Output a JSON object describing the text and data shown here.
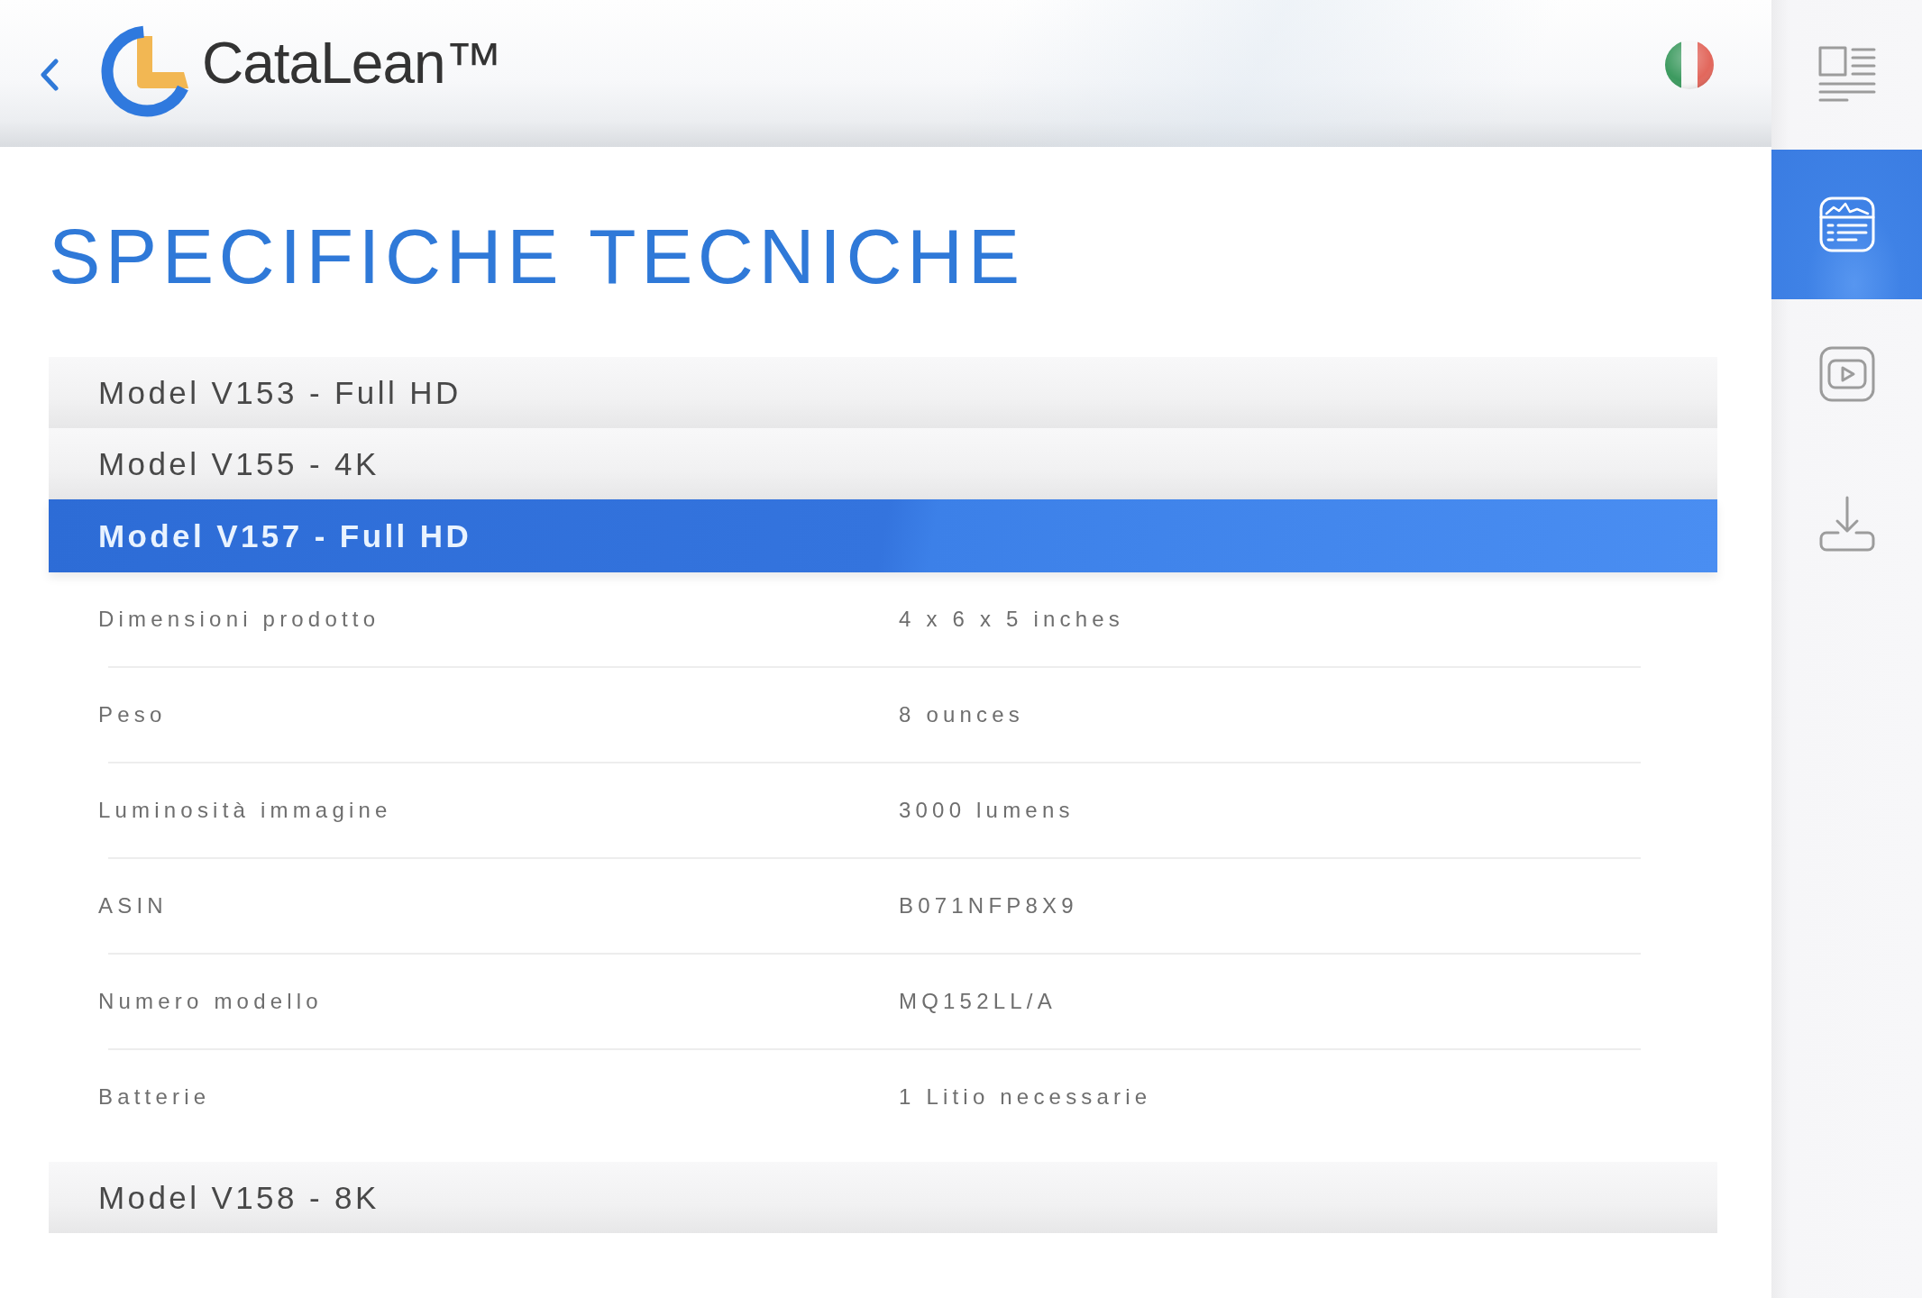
{
  "header": {
    "brand": "CataLean™"
  },
  "page_title": "SPECIFICHE TECNICHE",
  "models": [
    {
      "label": "Model V153 - Full HD",
      "expanded": false
    },
    {
      "label": "Model V155 - 4K",
      "expanded": false
    },
    {
      "label": "Model V157 - Full HD",
      "expanded": true,
      "specs": [
        {
          "name": "Dimensioni prodotto",
          "value": "4 x 6 x 5 inches"
        },
        {
          "name": "Peso",
          "value": "8 ounces"
        },
        {
          "name": "Luminosità immagine",
          "value": "3000 lumens"
        },
        {
          "name": "ASIN",
          "value": "B071NFP8X9"
        },
        {
          "name": "Numero modello",
          "value": "MQ152LL/A"
        },
        {
          "name": "Batterie",
          "value": "1 Litio necessarie"
        }
      ]
    },
    {
      "label": "Model V158 - 8K",
      "expanded": false
    }
  ],
  "sidebar": {
    "items": [
      {
        "kind": "article",
        "selected": false
      },
      {
        "kind": "datasheet",
        "selected": true
      },
      {
        "kind": "video",
        "selected": false
      },
      {
        "kind": "download",
        "selected": false
      }
    ]
  }
}
